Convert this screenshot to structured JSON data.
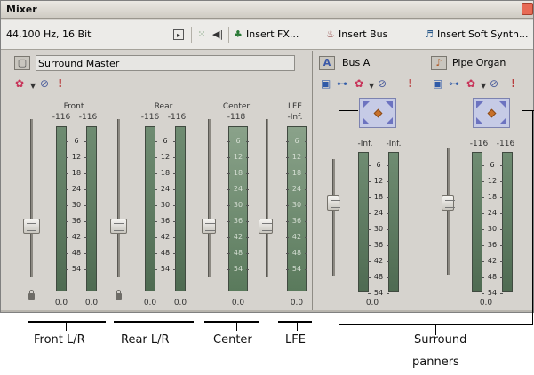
{
  "window": {
    "title": "Mixer"
  },
  "toolbar": {
    "format": "44,100 Hz, 16 Bit",
    "insert_fx": "Insert FX...",
    "insert_bus": "Insert Bus",
    "insert_soft_synth": "Insert Soft Synth..."
  },
  "strips": {
    "surround_master": {
      "name": "Surround Master",
      "channels": {
        "front": {
          "label": "Front",
          "peak_left": "-116",
          "peak_right": "-116",
          "value_left": "0.0",
          "value_right": "0.0"
        },
        "rear": {
          "label": "Rear",
          "peak_left": "-116",
          "peak_right": "-116",
          "value_left": "0.0",
          "value_right": "0.0"
        },
        "center": {
          "label": "Center",
          "peak": "-118",
          "value": "0.0"
        },
        "lfe": {
          "label": "LFE",
          "peak": "-Inf.",
          "value": "0.0"
        }
      }
    },
    "bus_a": {
      "name": "Bus A",
      "peak_left": "-Inf.",
      "peak_right": "-Inf.",
      "value": "0.0"
    },
    "pipe_organ": {
      "name": "Pipe Organ",
      "peak_left": "-116",
      "peak_right": "-116",
      "value": "0.0"
    }
  },
  "scale_ticks": [
    "6",
    "12",
    "18",
    "24",
    "30",
    "36",
    "42",
    "48",
    "54"
  ],
  "callouts": {
    "front": "Front L/R",
    "rear": "Rear L/R",
    "center": "Center",
    "lfe": "LFE",
    "surround_1": "Surround",
    "surround_2": "panners"
  }
}
